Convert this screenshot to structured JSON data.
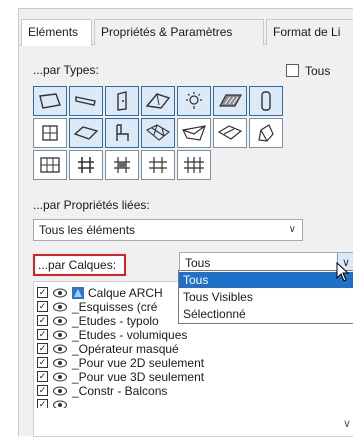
{
  "tabs": [
    "Eléments",
    "Propriétés & Paramètres",
    "Format de Li"
  ],
  "types": {
    "label": "...par Types:",
    "all_label": "Tous"
  },
  "linked": {
    "label": "...par Propriétés liées:",
    "value": "Tous les éléments"
  },
  "calques": {
    "label": "...par Calques:",
    "combo_value": "Tous",
    "options": [
      "Tous",
      "Tous Visibles",
      "Sélectionné"
    ]
  },
  "layers": [
    "Calque ARCH",
    "_Esquisses (cré",
    "_Etudes - typolo",
    "_Etudes - volumiques",
    "_Opérateur masqué",
    "_Pour vue 2D seulement",
    "_Pour vue 3D seulement",
    "_Constr - Balcons"
  ],
  "icons": [
    "wall",
    "beam",
    "door",
    "roof",
    "lamp",
    "slab-hatch",
    "column",
    "window",
    "slab",
    "chair",
    "mesh",
    "skylight",
    "shell",
    "morph",
    "curtain-wall",
    "stair",
    "railing",
    "truss",
    "grid-structure"
  ]
}
